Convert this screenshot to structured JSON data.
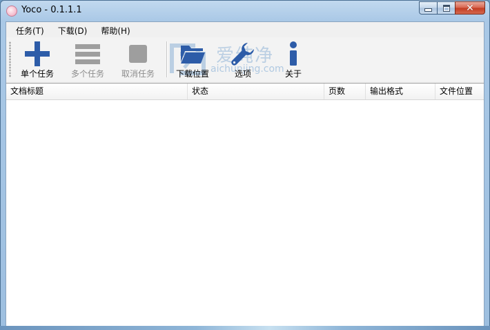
{
  "window": {
    "title": "Yoco - 0.1.1.1"
  },
  "menu": [
    {
      "label": "任务(T)"
    },
    {
      "label": "下载(D)"
    },
    {
      "label": "帮助(H)"
    }
  ],
  "toolbar": {
    "single_task": "单个任务",
    "multi_task": "多个任务",
    "cancel_task": "取消任务",
    "download_location": "下载位置",
    "options": "选项",
    "about": "关于"
  },
  "watermark": {
    "title": "爱纯净",
    "url": "aichunjing.com"
  },
  "table": {
    "columns": [
      "文档标题",
      "状态",
      "页数",
      "输出格式",
      "文件位置"
    ]
  },
  "colors": {
    "icon_blue": "#2d5ca8",
    "icon_disabled": "#9e9e9e"
  }
}
